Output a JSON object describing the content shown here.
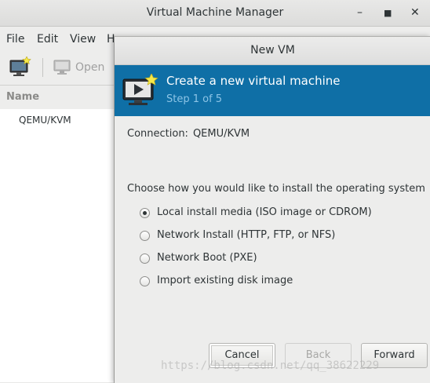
{
  "main_window": {
    "title": "Virtual Machine Manager",
    "menu": [
      "File",
      "Edit",
      "View",
      "H"
    ],
    "toolbar": {
      "open_label": "Open"
    },
    "list": {
      "column_name": "Name",
      "rows": [
        "QEMU/KVM"
      ]
    }
  },
  "dialog": {
    "title": "New VM",
    "banner": {
      "title": "Create a new virtual machine",
      "step": "Step 1 of 5"
    },
    "connection": {
      "label": "Connection:",
      "value": "QEMU/KVM"
    },
    "prompt": "Choose how you would like to install the operating system",
    "options": [
      {
        "label": "Local install media (ISO image or CDROM)",
        "selected": true
      },
      {
        "label": "Network Install (HTTP, FTP, or NFS)",
        "selected": false
      },
      {
        "label": "Network Boot (PXE)",
        "selected": false
      },
      {
        "label": "Import existing disk image",
        "selected": false
      }
    ],
    "buttons": {
      "cancel": "Cancel",
      "back": "Back",
      "forward": "Forward"
    }
  },
  "watermark": "https://blog.csdn.net/qq_38622229",
  "colors": {
    "banner": "#0f6fa6",
    "banner_step": "#8cc4e6"
  }
}
